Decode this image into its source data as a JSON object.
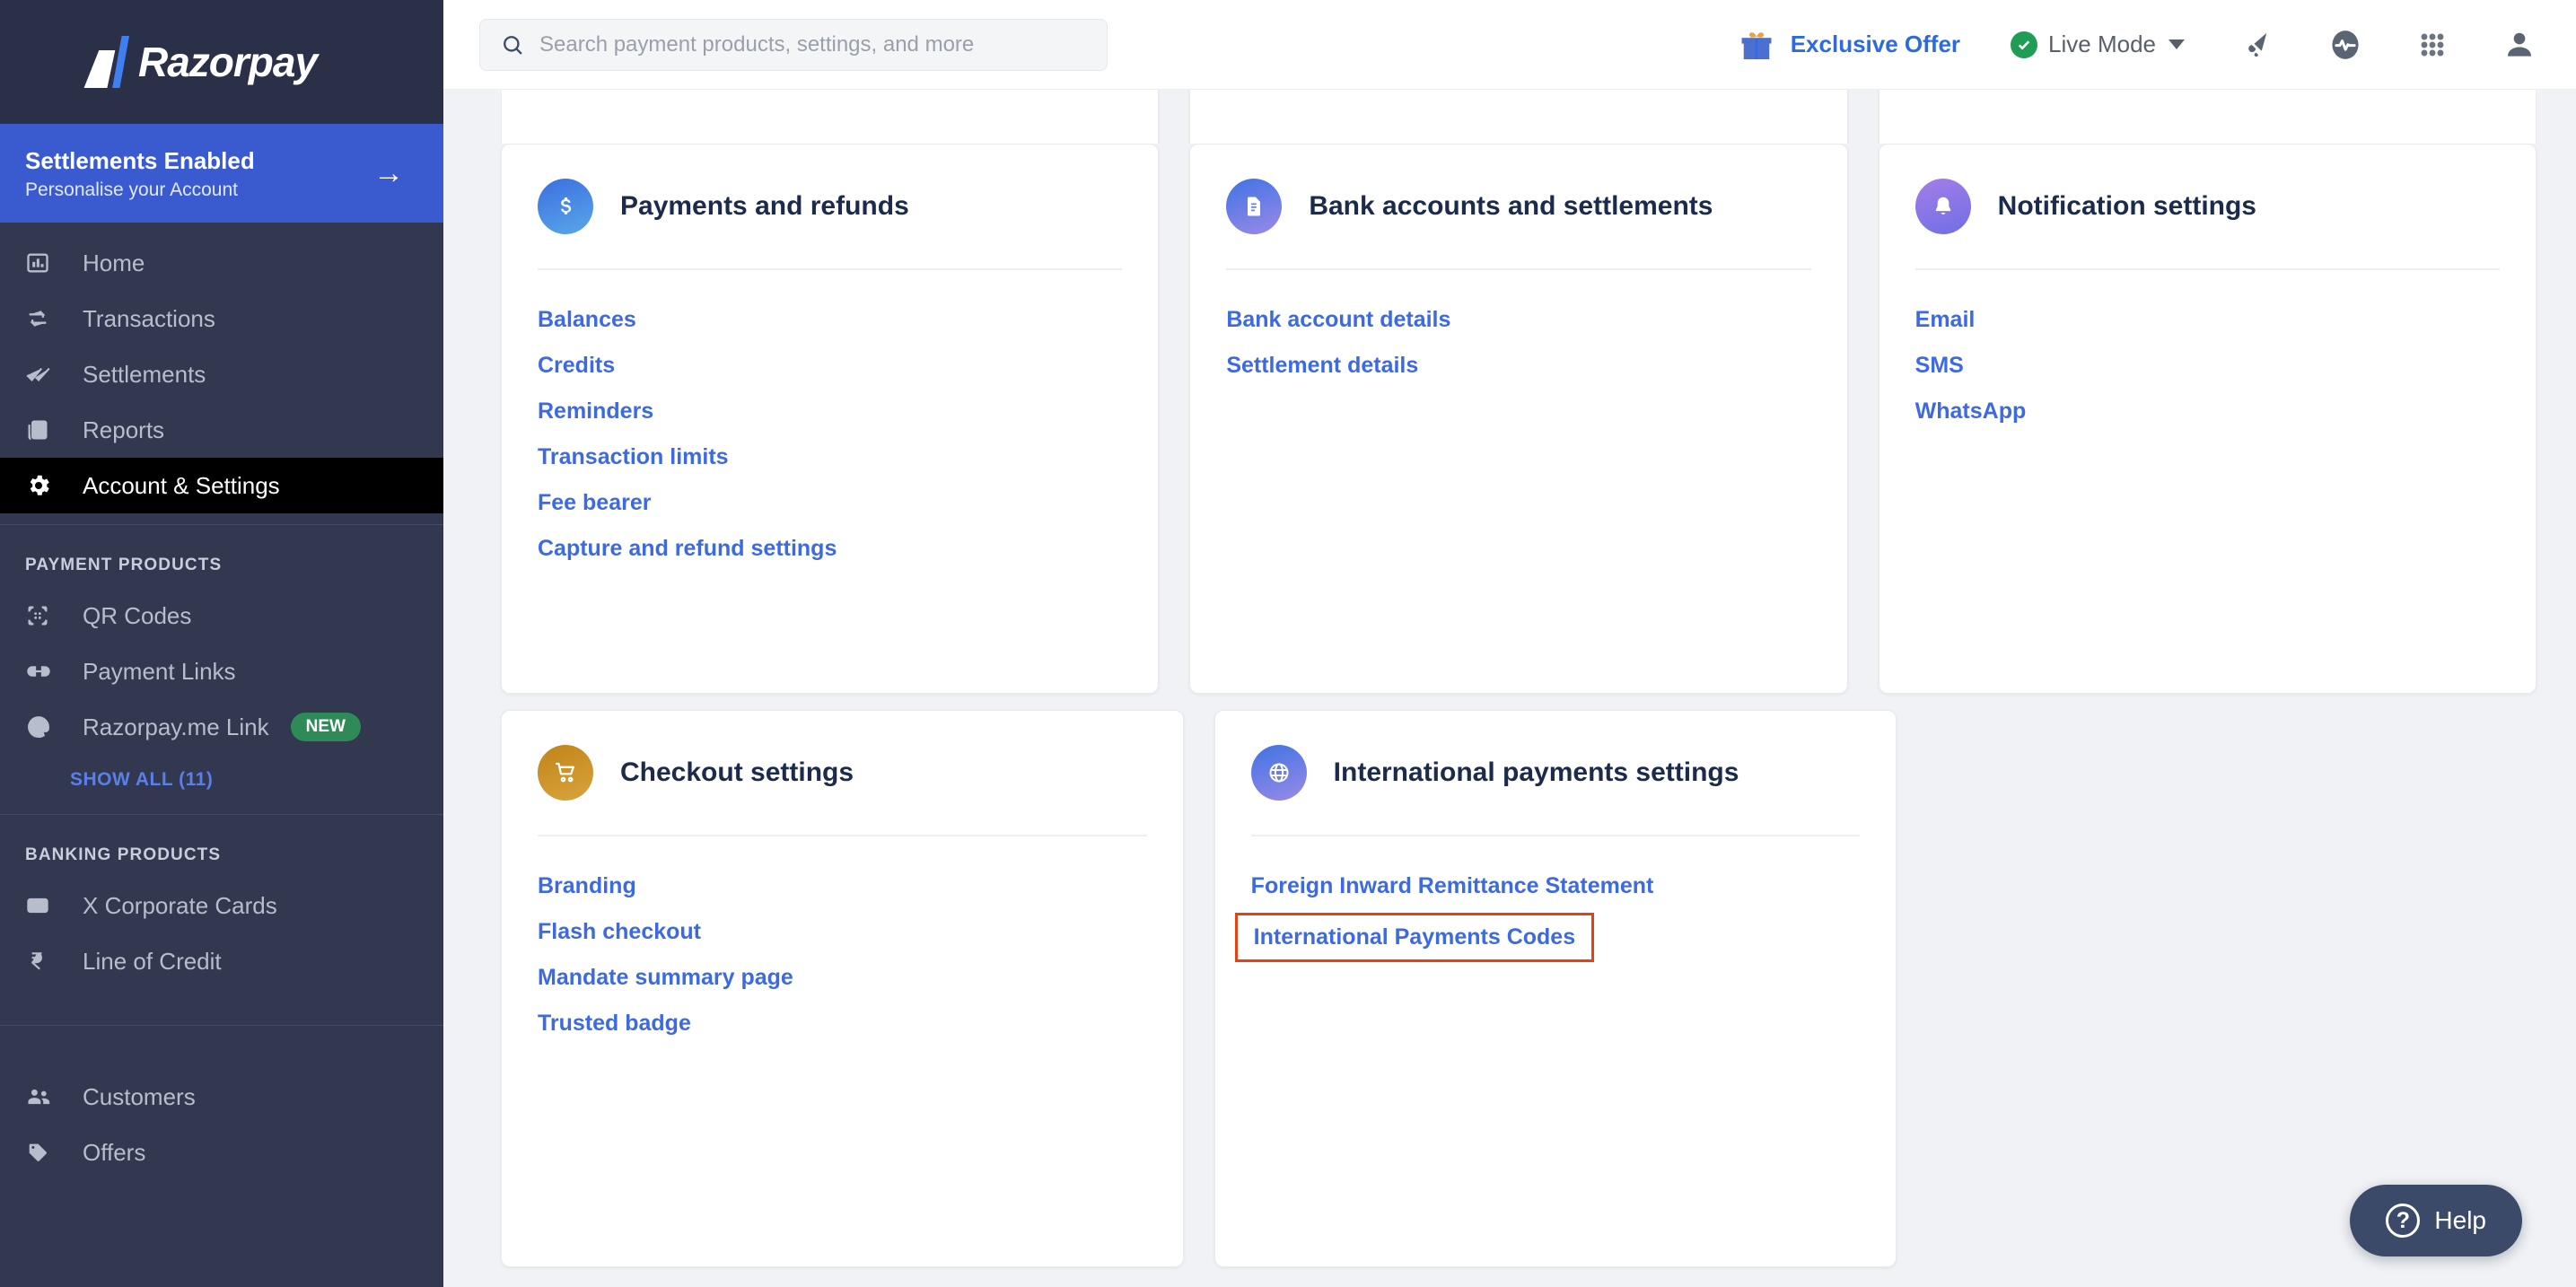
{
  "brand": {
    "name": "Razorpay"
  },
  "sidebar": {
    "banner": {
      "title": "Settlements Enabled",
      "subtitle": "Personalise your Account",
      "arrow": "→"
    },
    "main_items": [
      {
        "label": "Home",
        "icon": "bar-chart-icon",
        "active": false
      },
      {
        "label": "Transactions",
        "icon": "transfer-icon",
        "active": false
      },
      {
        "label": "Settlements",
        "icon": "double-check-icon",
        "active": false
      },
      {
        "label": "Reports",
        "icon": "report-icon",
        "active": false
      },
      {
        "label": "Account & Settings",
        "icon": "gear-icon",
        "active": true
      }
    ],
    "payment_products": {
      "label": "PAYMENT PRODUCTS",
      "items": [
        {
          "label": "QR Codes",
          "icon": "qr-code-icon",
          "badge": ""
        },
        {
          "label": "Payment Links",
          "icon": "link-icon",
          "badge": ""
        },
        {
          "label": "Razorpay.me Link",
          "icon": "at-sign-icon",
          "badge": "NEW"
        }
      ],
      "show_all": "SHOW ALL (11)"
    },
    "banking_products": {
      "label": "BANKING PRODUCTS",
      "items": [
        {
          "label": "X Corporate Cards",
          "icon": "credit-card-icon"
        },
        {
          "label": "Line of Credit",
          "icon": "rupee-icon"
        }
      ]
    },
    "other_items": [
      {
        "label": "Customers",
        "icon": "people-icon"
      },
      {
        "label": "Offers",
        "icon": "tag-icon"
      }
    ]
  },
  "topbar": {
    "search": {
      "placeholder": "Search payment products, settings, and more",
      "value": "",
      "icon": "search-icon"
    },
    "offer": {
      "label": "Exclusive Offer",
      "icon": "gift-icon"
    },
    "mode": {
      "label": "Live Mode",
      "icon": "check-circle-icon",
      "caret": "chevron-down-icon"
    },
    "icons": [
      {
        "name": "announcement-icon"
      },
      {
        "name": "activity-pulse-icon"
      },
      {
        "name": "apps-grid-icon"
      },
      {
        "name": "profile-icon"
      }
    ]
  },
  "cards": [
    {
      "title": "Payments and refunds",
      "icon": "dollar-icon",
      "icon_gradient": [
        "#3b6fe0",
        "#59a7e8"
      ],
      "links": [
        "Balances",
        "Credits",
        "Reminders",
        "Transaction limits",
        "Fee bearer",
        "Capture and refund settings"
      ]
    },
    {
      "title": "Bank accounts and settlements",
      "icon": "document-icon",
      "icon_gradient": [
        "#3f73e3",
        "#9a8ae8"
      ],
      "links": [
        "Bank account details",
        "Settlement details"
      ]
    },
    {
      "title": "Notification settings",
      "icon": "bell-icon",
      "icon_gradient": [
        "#a47ee8",
        "#6f6ee6"
      ],
      "links": [
        "Email",
        "SMS",
        "WhatsApp"
      ]
    },
    {
      "title": "Checkout settings",
      "icon": "shopping-cart-icon",
      "icon_gradient": [
        "#c08418",
        "#d9a43d"
      ],
      "links": [
        "Branding",
        "Flash checkout",
        "Mandate summary page",
        "Trusted badge"
      ]
    },
    {
      "title": "International payments settings",
      "icon": "globe-icon",
      "icon_gradient": [
        "#3f73e3",
        "#9a8ae8"
      ],
      "links": [
        "Foreign Inward Remittance Statement",
        "International Payments Codes"
      ],
      "highlighted_link": "International Payments Codes",
      "highlight_color": "#e8400f"
    }
  ],
  "help": {
    "label": "Help",
    "icon": "question-circle-icon",
    "glyph": "?"
  }
}
